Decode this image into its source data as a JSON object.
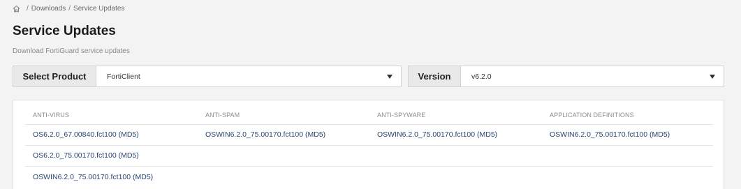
{
  "breadcrumb": {
    "items": [
      "Downloads",
      "Service Updates"
    ]
  },
  "page": {
    "title": "Service Updates",
    "subtitle": "Download FortiGuard service updates"
  },
  "product_select": {
    "label": "Select Product",
    "value": "FortiClient"
  },
  "version_select": {
    "label": "Version",
    "value": "v6.2.0"
  },
  "table": {
    "columns": [
      "ANTI-VIRUS",
      "ANTI-SPAM",
      "ANTI-SPYWARE",
      "APPLICATION DEFINITIONS"
    ],
    "rows": [
      [
        "OS6.2.0_67.00840.fct100 (MD5)",
        "OSWIN6.2.0_75.00170.fct100 (MD5)",
        "OSWIN6.2.0_75.00170.fct100 (MD5)",
        "OSWIN6.2.0_75.00170.fct100 (MD5)"
      ],
      [
        "OS6.2.0_75.00170.fct100 (MD5)",
        "",
        "",
        ""
      ],
      [
        "OSWIN6.2.0_75.00170.fct100 (MD5)",
        "",
        "",
        ""
      ]
    ]
  },
  "icons": {
    "home": "home-icon",
    "dropdown": "chevron-down-icon"
  },
  "colors": {
    "background": "#f3f3f3",
    "link": "#27456f",
    "label_bg": "#e9e9e9"
  }
}
